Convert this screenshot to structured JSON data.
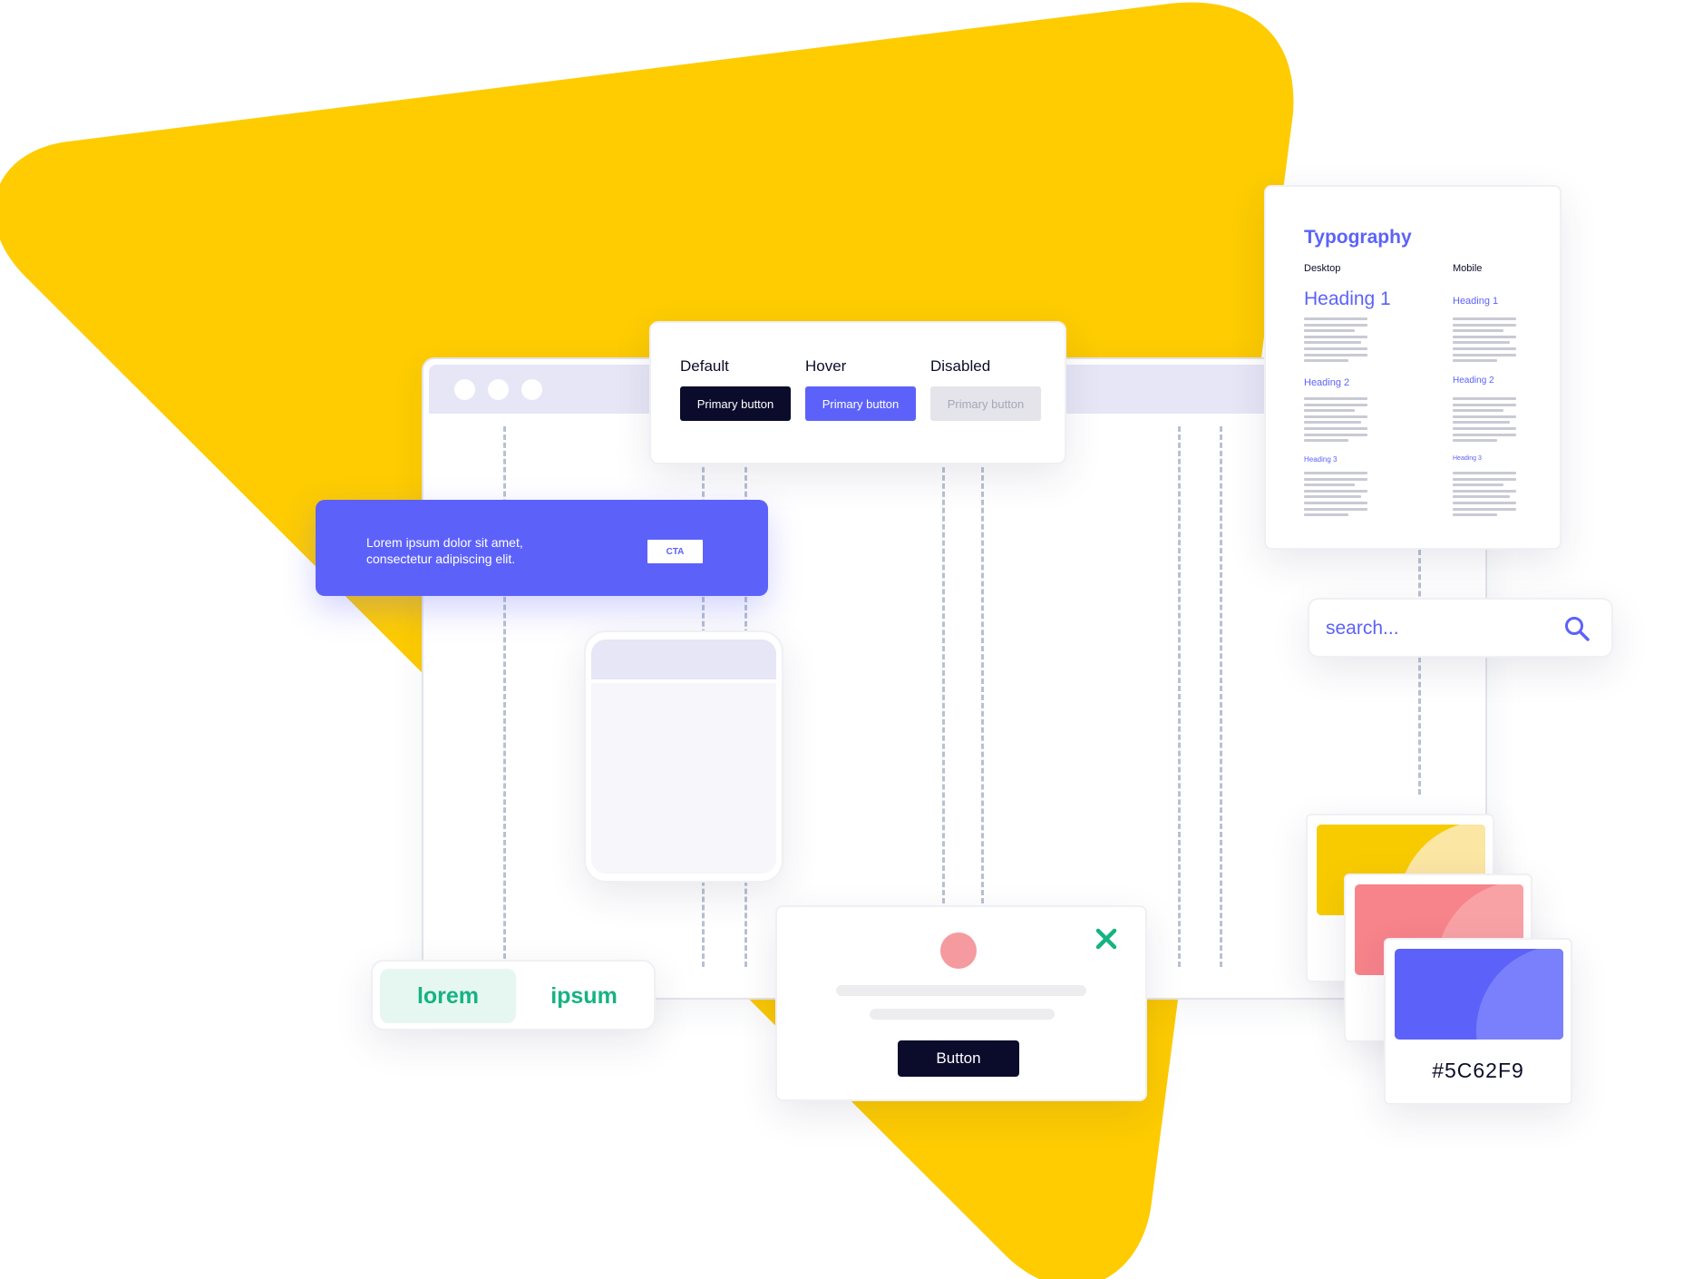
{
  "colors": {
    "accent": "#5C62F9",
    "brand_yellow": "#FECC00",
    "dark": "#0B0C2C",
    "green": "#16B382",
    "coral": "#F7838B",
    "surface_lavender": "#E6E6F6"
  },
  "button_states": {
    "default": {
      "label": "Default",
      "button": "Primary button"
    },
    "hover": {
      "label": "Hover",
      "button": "Primary button"
    },
    "disabled": {
      "label": "Disabled",
      "button": "Primary button"
    }
  },
  "banner": {
    "text_line1": "Lorem ipsum dolor sit amet,",
    "text_line2": "consectetur adipiscing elit.",
    "cta": "CTA"
  },
  "toggle": {
    "options": [
      "lorem",
      "ipsum"
    ],
    "selected": "lorem"
  },
  "modal": {
    "button": "Button",
    "close_icon": "close-icon"
  },
  "typography": {
    "title": "Typography",
    "desktop_label": "Desktop",
    "mobile_label": "Mobile",
    "desktop": {
      "h1": "Heading 1",
      "h2": "Heading 2",
      "h3": "Heading 3"
    },
    "mobile": {
      "h1": "Heading 1",
      "h2": "Heading 2",
      "h3": "Heading 3"
    }
  },
  "search": {
    "placeholder": "search...",
    "icon": "search-icon"
  },
  "swatches": {
    "hex": "#5C62F9"
  }
}
